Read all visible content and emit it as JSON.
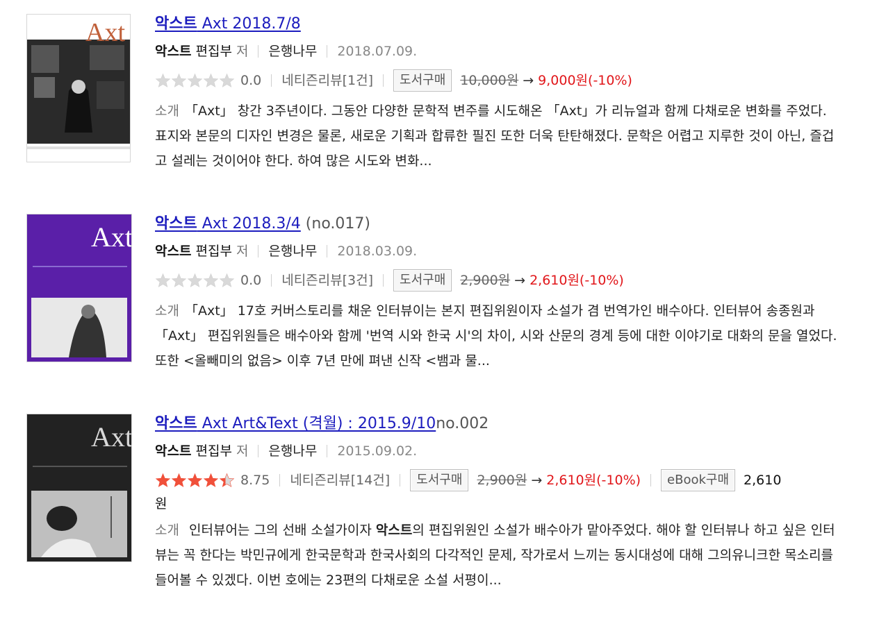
{
  "colors": {
    "link": "#1c1cbe",
    "sale": "#e1161a",
    "star_on": "#f0503a",
    "star_off": "#d9d9d9"
  },
  "items": [
    {
      "cover": {
        "title_text": "Axt",
        "style": "photo-bw"
      },
      "title": {
        "bold": "악스트",
        "rest": " Axt 2018.7/8",
        "suffix": ""
      },
      "author": "악스트",
      "author_rest": " 편집부",
      "role": "저",
      "publisher": "은행나무",
      "date": "2018.07.09.",
      "rating": {
        "value": 0.0,
        "label": "0.0",
        "stars_filled": 0
      },
      "review": "네티즌리뷰[1건]",
      "buy_label": "도서구매",
      "old_price": "10,000원",
      "arrow": "→",
      "sale_price": "9,000원(-10%)",
      "desc_label": "소개",
      "description": "「Axt」 창간 3주년이다. 그동안 다양한 문학적 변주를 시도해온 「Axt」가 리뉴얼과 함께 다채로운 변화를 주었다. 표지와 본문의 디자인 변경은 물론, 새로운 기획과 합류한 필진 또한 더욱 탄탄해졌다. 문학은 어렵고 지루한 것이 아닌, 즐겁고 설레는 것이어야 한다. 하여 많은 시도와 변화..."
    },
    {
      "cover": {
        "title_text": "Axt",
        "style": "purple"
      },
      "title": {
        "bold": "악스트",
        "rest": " Axt 2018.3/4",
        "suffix": " (no.017)"
      },
      "author": "악스트",
      "author_rest": " 편집부",
      "role": "저",
      "publisher": "은행나무",
      "date": "2018.03.09.",
      "rating": {
        "value": 0.0,
        "label": "0.0",
        "stars_filled": 0
      },
      "review": "네티즌리뷰[3건]",
      "buy_label": "도서구매",
      "old_price": "2,900원",
      "arrow": "→",
      "sale_price": "2,610원(-10%)",
      "desc_label": "소개",
      "description": "「Axt」 17호 커버스토리를 채운 인터뷰이는 본지 편집위원이자 소설가 겸 번역가인 배수아다. 인터뷰어 송종원과 「Axt」 편집위원들은 배수아와 함께 '번역 시와 한국 시'의 차이, 시와 산문의 경계 등에 대한 이야기로 대화의 문을 열었다. 또한 <올빼미의 없음> 이후 7년 만에 펴낸 신작 <뱀과 물..."
    },
    {
      "cover": {
        "title_text": "Axt",
        "style": "dark"
      },
      "title": {
        "bold": "악스트",
        "rest": " Axt Art&Text (격월) : 2015.9/10",
        "suffix": "no.002"
      },
      "author": "악스트",
      "author_rest": " 편집부",
      "role": "저",
      "publisher": "은행나무",
      "date": "2015.09.02.",
      "rating": {
        "value": 8.75,
        "label": "8.75",
        "stars_filled": 4.4
      },
      "review": "네티즌리뷰[14건]",
      "buy_label": "도서구매",
      "old_price": "2,900원",
      "arrow": "→",
      "sale_price": "2,610원(-10%)",
      "ebook_label": "eBook구매",
      "ebook_price": "2,610",
      "ebook_unit": "원",
      "desc_label": "소개",
      "description_pre": " 인터뷰어는 그의 선배 소설가이자 ",
      "description_bold": "악스트",
      "description_post": "의 편집위원인 소설가 배수아가 맡아주었다. 해야 할 인터뷰나 하고 싶은 인터뷰는 꼭 한다는 박민규에게 한국문학과 한국사회의 다각적인 문제, 작가로서 느끼는 동시대성에 대해 그의유니크한 목소리를 들어볼 수 있겠다. 이번 호에는 23편의 다채로운 소설 서평이..."
    }
  ]
}
